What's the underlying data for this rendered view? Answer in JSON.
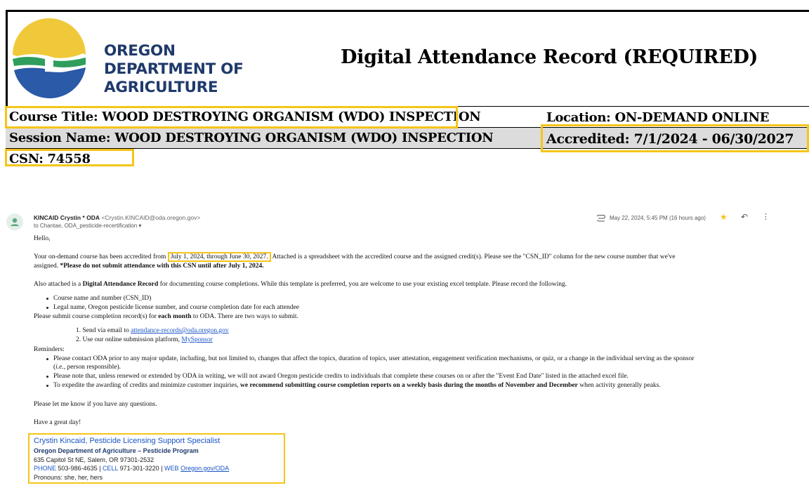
{
  "header": {
    "org_name_lines": [
      "OREGON",
      "DEPARTMENT OF",
      "AGRICULTURE"
    ],
    "doc_title": "Digital Attendance Record (REQUIRED)"
  },
  "fields": {
    "course_title": "Course Title: WOOD DESTROYING ORGANISM (WDO) INSPECTION",
    "location": "Location: ON-DEMAND ONLINE",
    "session_name": "Session Name: WOOD DESTROYING ORGANISM (WDO) INSPECTION",
    "accredited": "Accredited: 7/1/2024 - 06/30/2027",
    "csn": "CSN:  74558"
  },
  "colors": {
    "highlight": "#f5c518",
    "logo_yellow": "#f0c93a",
    "logo_green": "#2f9e5c",
    "logo_blue": "#2a5aa8",
    "org_text": "#1f3a6b",
    "link": "#1a55c7"
  },
  "email": {
    "sender_name": "KINCAID Crystin * ODA",
    "sender_email": "<Crystin.KINCAID@oda.oregon.gov>",
    "recipients": "to Chantae, ODA_pesticide-recertification",
    "timestamp": "May 22, 2024, 5:45 PM (16 hours ago)",
    "icons": [
      "person-avatar-icon",
      "attachment-icon",
      "star-icon",
      "reply-icon",
      "more-options-icon",
      "dropdown-caret-icon"
    ],
    "greeting": "Hello,",
    "p1_a": "Your on-demand course has been accredited from",
    "p1_dates": "July 1, 2024, through June 30, 2027.",
    "p1_b": "Attached is a spreadsheet with the accredited course and the assigned credit(s). Please see the \"CSN_ID\" column for the new course number that we've",
    "p1_c": "assigned.",
    "p1_bold": "*Please do not submit attendance with this CSN until after July 1, 2024.",
    "p2_a": "Also attached is a",
    "p2_bold": "Digital Attendance Record",
    "p2_b": "for documenting course completions. While this template is preferred, you are welcome to use your existing excel template. Please record the following.",
    "record_items": [
      "Course name and number (CSN_ID)",
      "Legal name, Oregon pesticide license number, and course completion date for each attendee"
    ],
    "submit_a": "Please submit course completion record(s) for",
    "submit_bold": "each month",
    "submit_b": "to ODA.  There are two ways to submit.",
    "way1_a": "1. Send via email to",
    "way1_link": "attendance-records@oda.oregon.gov",
    "way2_a": "2. Use our online submission platform,",
    "way2_link": "MySponsor",
    "reminders_label": "Reminders:",
    "rem1_line1": "Please contact ODA prior to any major update, including, but not limited to, changes that affect the topics, duration of topics, user attestation, engagement verification mechanisms, or quiz, or a change in the individual serving as the sponsor",
    "rem1_ie": "i.e.,",
    "rem1_line2b": "person responsible).",
    "rem2": "Please note that, unless renewed or extended by ODA in writing, we will not award Oregon pesticide credits to individuals that complete these courses on or after the \"Event End Date\" listed in the attached excel file.",
    "rem3_a": "To expedite the awarding of credits and minimize customer inquiries,",
    "rem3_bold": "we recommend submitting course completion reports on a weekly basis during the months of November and December",
    "rem3_b": "when activity generally peaks.",
    "questions": "Please let me know if you have any questions.",
    "closing": "Have a great day!"
  },
  "signature": {
    "name_title": "Crystin Kincaid, Pesticide Licensing Support Specialist",
    "org": "Oregon Department of Agriculture – Pesticide Program",
    "address": "635 Capitol St NE, Salem, OR 97301-2532",
    "phone_label": "PHONE",
    "phone": "503-986-4635",
    "cell_label": "CELL",
    "cell": "971-301-3220",
    "web_label": "WEB",
    "web_link": "Oregon.gov/ODA",
    "pronouns": "Pronouns: she, her, hers"
  }
}
